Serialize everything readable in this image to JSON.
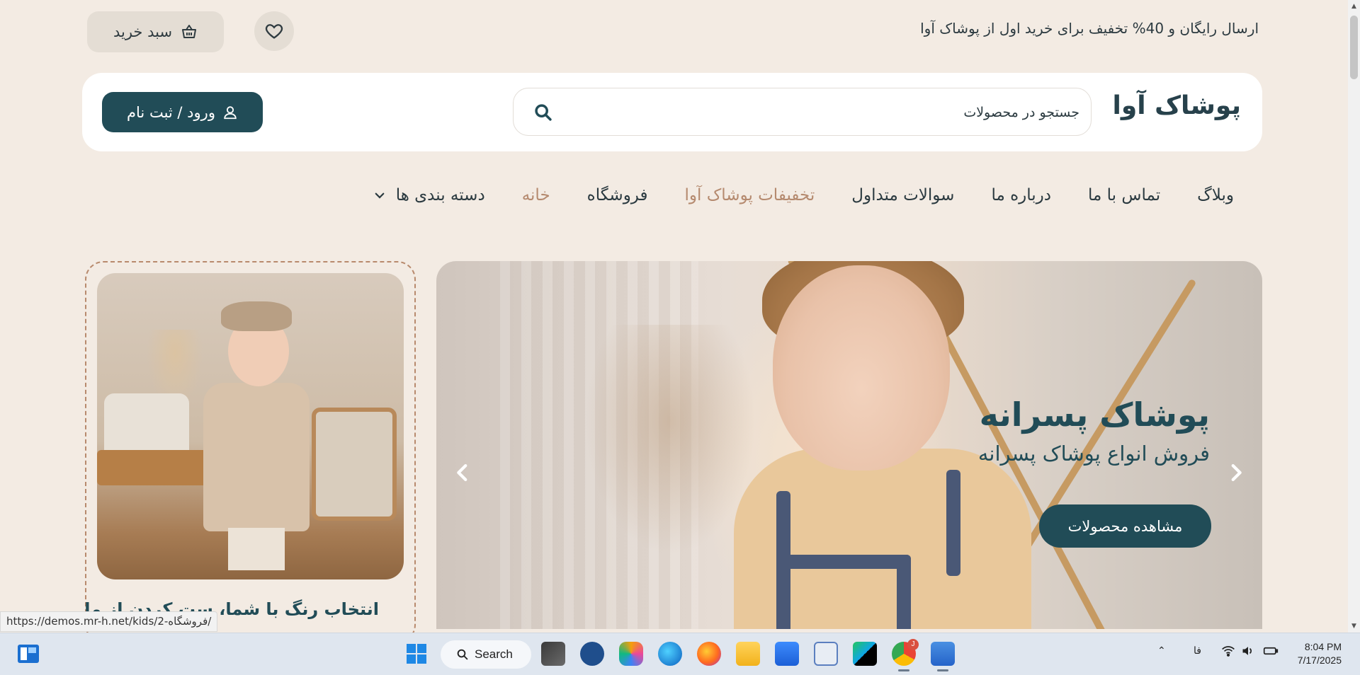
{
  "topbar": {
    "promo": "ارسال رایگان و 40% تخفیف برای خرید اول از پوشاک آوا",
    "cart_label": "سبد خرید"
  },
  "header": {
    "logo": "پوشاک آوا",
    "search_placeholder": "جستجو در محصولات",
    "login_label": "ورود / ثبت نام"
  },
  "nav": {
    "categories": "دسته بندی ها",
    "items": [
      "خانه",
      "فروشگاه",
      "تخفیفات پوشاک آوا",
      "سوالات متداول",
      "درباره ما",
      "تماس با ما",
      "وبلاگ"
    ]
  },
  "hero": {
    "title": "پوشاک پسرانه",
    "subtitle": "فروش انواع پوشاک پسرانه",
    "button": "مشاهده محصولات"
  },
  "side_card": {
    "caption": "انتخاب رنگ با شما، ست کردن از ما"
  },
  "status_bar": {
    "url": "https://demos.mr-h.net/kids/فروشگاه-2/"
  },
  "taskbar": {
    "search_label": "Search",
    "language": "فا",
    "time": "8:04 PM",
    "date": "7/17/2025",
    "chrome_badge": "J"
  },
  "colors": {
    "page_bg": "#f3ebe3",
    "primary": "#214c57",
    "accent": "#b58a6f",
    "card_bg": "#ffffff"
  },
  "icons": {
    "cart": "basket-icon",
    "favorite": "heart-icon",
    "search": "search-icon",
    "login": "user-icon",
    "categories": "chevron-down-icon",
    "prev": "chevron-left-icon",
    "next": "chevron-right-icon"
  }
}
